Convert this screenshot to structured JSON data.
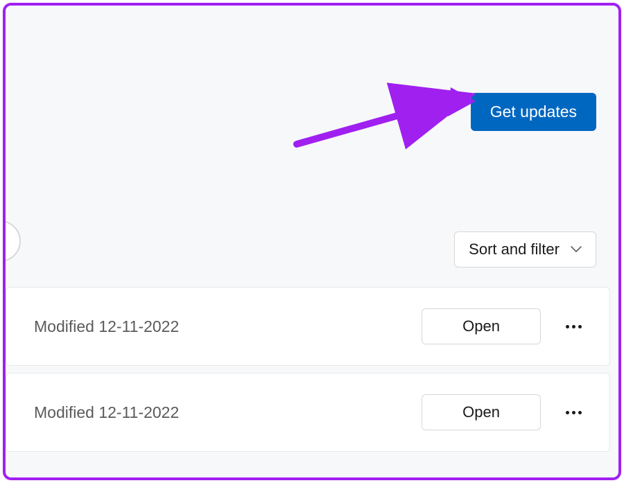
{
  "header": {
    "get_updates_label": "Get updates"
  },
  "filter": {
    "sort_filter_label": "Sort and filter"
  },
  "items": [
    {
      "modified_text": "Modified 12-11-2022",
      "open_label": "Open"
    },
    {
      "modified_text": "Modified 12-11-2022",
      "open_label": "Open"
    }
  ]
}
